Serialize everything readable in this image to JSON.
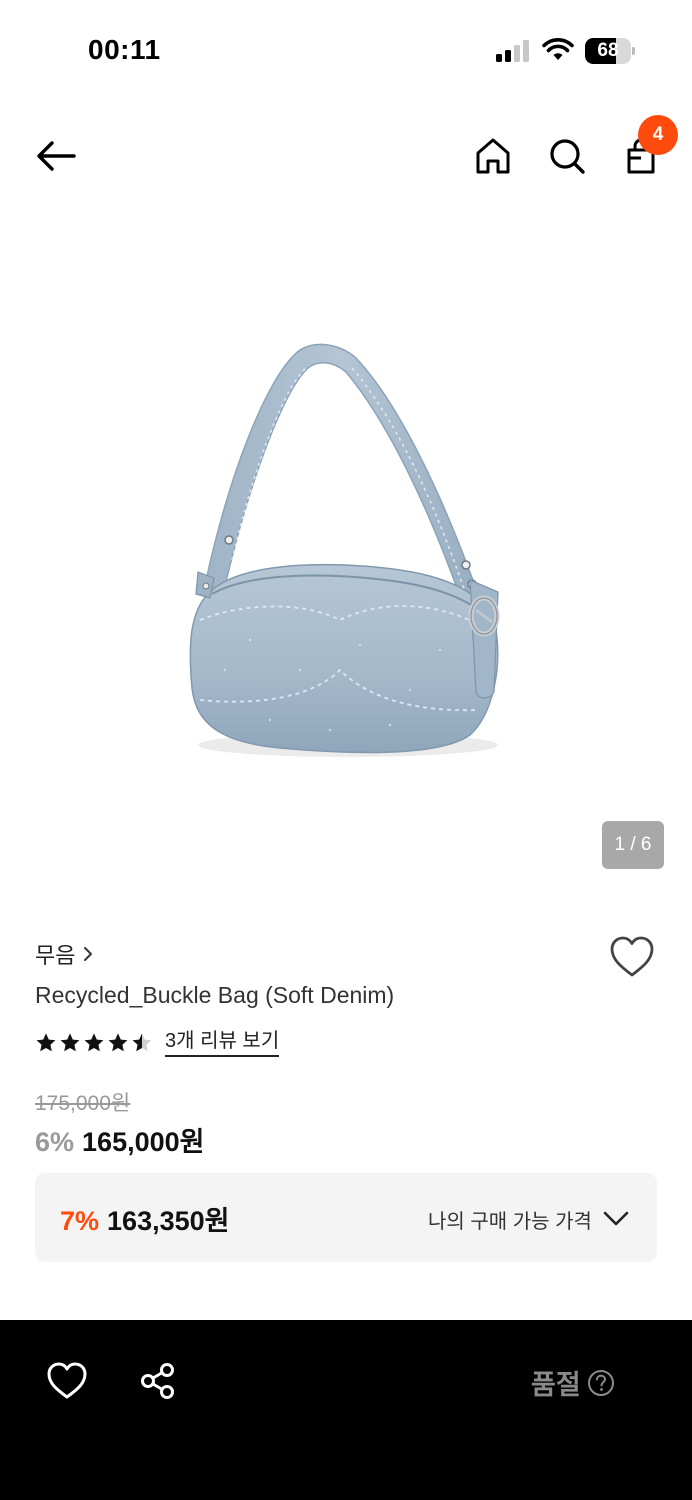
{
  "status_bar": {
    "time": "00:11",
    "battery_level": "68",
    "battery_fraction": 0.68
  },
  "nav": {
    "back_icon": "arrow-left-icon",
    "home_icon": "home-icon",
    "search_icon": "search-icon",
    "cart_icon": "shopping-bag-icon",
    "cart_badge": "4"
  },
  "gallery": {
    "page_indicator": "1 / 6",
    "current": 1,
    "total": 6
  },
  "product": {
    "brand": "무음",
    "name": "Recycled_Buckle Bag (Soft Denim)",
    "rating": 4.5,
    "rating_max": 5,
    "review_link": "3개 리뷰 보기",
    "original_price": "175,000원",
    "discount_rate": "6%",
    "sale_price": "165,000원"
  },
  "my_price": {
    "discount_rate": "7%",
    "price": "163,350원",
    "label": "나의 구매 가능 가격"
  },
  "bottom_bar": {
    "wish_icon": "heart-icon",
    "share_icon": "share-icon",
    "soldout_label": "품절",
    "help_icon": "question-circle-icon"
  },
  "colors": {
    "accent": "#ff4a0d",
    "bottom_bar": "#000000",
    "price_box": "#f4f4f4",
    "denim": "#a9bccd"
  }
}
